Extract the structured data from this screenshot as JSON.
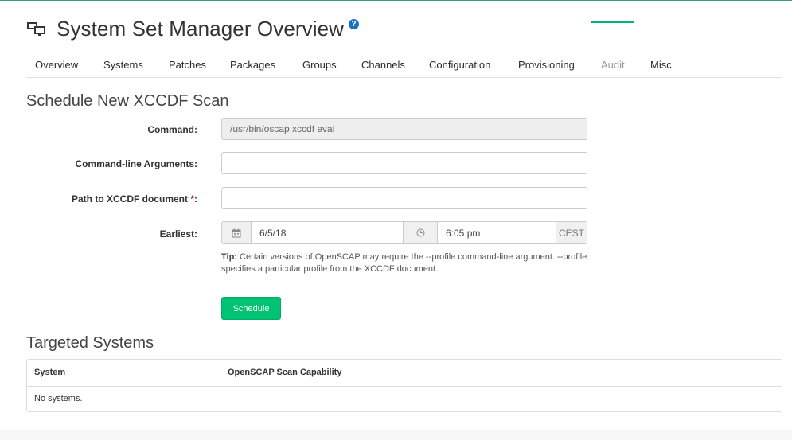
{
  "header": {
    "title": "System Set Manager Overview",
    "help_icon": "question-circle-icon",
    "desktop_icon": "desktop-icon"
  },
  "tabs": [
    {
      "label": "Overview",
      "active": false
    },
    {
      "label": "Systems",
      "active": false
    },
    {
      "label": "Patches",
      "active": false
    },
    {
      "label": "Packages",
      "active": false
    },
    {
      "label": "Groups",
      "active": false
    },
    {
      "label": "Channels",
      "active": false
    },
    {
      "label": "Configuration",
      "active": false
    },
    {
      "label": "Provisioning",
      "active": false
    },
    {
      "label": "Audit",
      "active": true
    },
    {
      "label": "Misc",
      "active": false
    }
  ],
  "accent_color": "#00b56d",
  "form": {
    "section_title": "Schedule New XCCDF Scan",
    "command": {
      "label": "Command:",
      "value": "/usr/bin/oscap xccdf eval"
    },
    "args": {
      "label": "Command-line Arguments:",
      "value": ""
    },
    "path": {
      "label": "Path to XCCDF document ",
      "required_mark": "*",
      "suffix": ":",
      "value": ""
    },
    "earliest": {
      "label": "Earliest:",
      "date": "6/5/18",
      "time": "6:05 pm",
      "timezone": "CEST",
      "calendar_icon": "calendar-icon",
      "clock_icon": "clock-icon"
    },
    "tip": {
      "prefix": "Tip:",
      "text": "Certain versions of OpenSCAP may require the --profile command-line argument. --profile specifies a particular profile from the XCCDF document."
    },
    "schedule_button": "Schedule"
  },
  "targeted": {
    "section_title": "Targeted Systems",
    "columns": [
      "System",
      "OpenSCAP Scan Capability"
    ],
    "empty_text": "No systems."
  }
}
